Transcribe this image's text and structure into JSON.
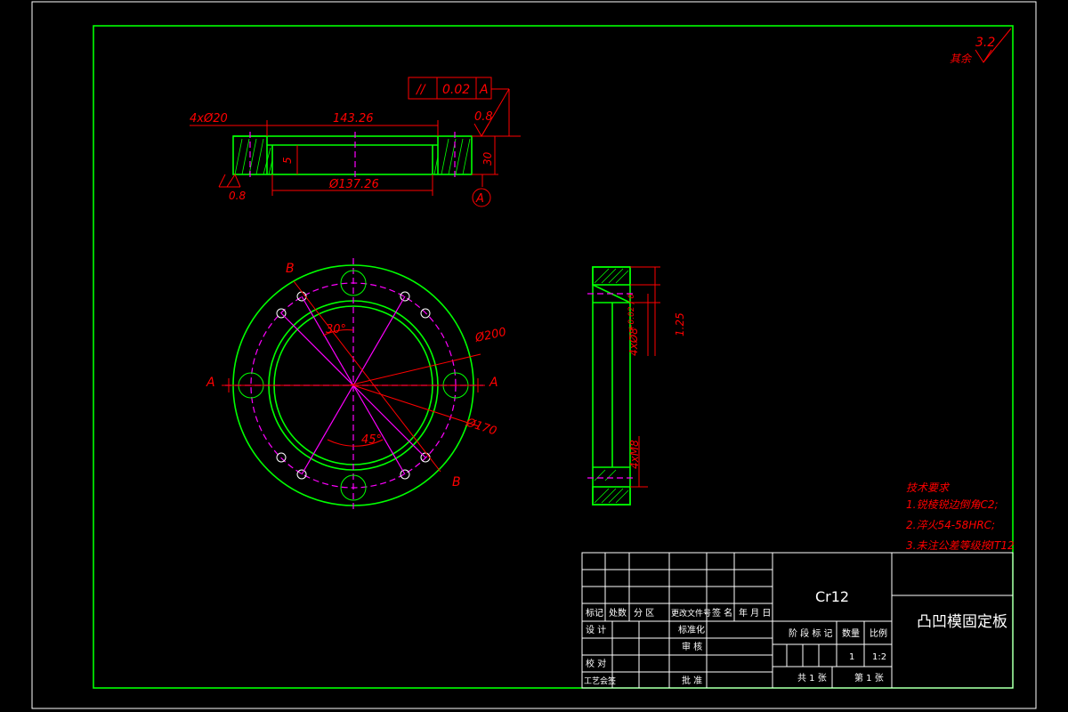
{
  "title_block": {
    "material": "Cr12",
    "part_name": "凸凹模固定板",
    "row_labels": [
      "标记",
      "处数",
      "分 区",
      "更改文件号",
      "签 名",
      "年 月 日"
    ],
    "design": "设 计",
    "standardize": "标准化",
    "check": "校 对",
    "review": "审 核",
    "process": "工艺会签",
    "approve": "批 准",
    "stage_mark": "阶 段 标 记",
    "weight": "数量",
    "scale": "比例",
    "weight_value": "1",
    "scale_value": "1:2",
    "sheets_total": "共 1 张",
    "sheet_no": "第 1 张"
  },
  "roughness": {
    "other_label": "其余",
    "other_value": "3.2",
    "top_value": "0.8",
    "bottom_value": "0.8"
  },
  "tolerance": {
    "symbol": "//",
    "value": "0.02",
    "datum": "A",
    "datum_tag": "A"
  },
  "dimensions": {
    "holes_top": "4xØ20",
    "width_top": "143.26",
    "depth": "5",
    "thickness": "30",
    "inner_dia": "Ø137.26",
    "outer_dia": "Ø200",
    "pcd": "Ø170",
    "angle_30": "30°",
    "angle_45": "45°",
    "section_a": "A",
    "section_b": "B",
    "side_holes": "4xØ8",
    "side_holes_tol": "+0.02 / 0",
    "side_chamfer": "1.25",
    "side_thread": "4xM8"
  },
  "tech_requirements": {
    "title": "技术要求",
    "items": [
      "1.锐棱锐边倒角C2;",
      "2.淬火54-58HRC;",
      "3.未注公差等级按IT12"
    ]
  },
  "colors": {
    "outline": "#00ff00",
    "dimension": "#ff0000",
    "centerline": "#ff00ff",
    "frame": "#ffffff"
  }
}
